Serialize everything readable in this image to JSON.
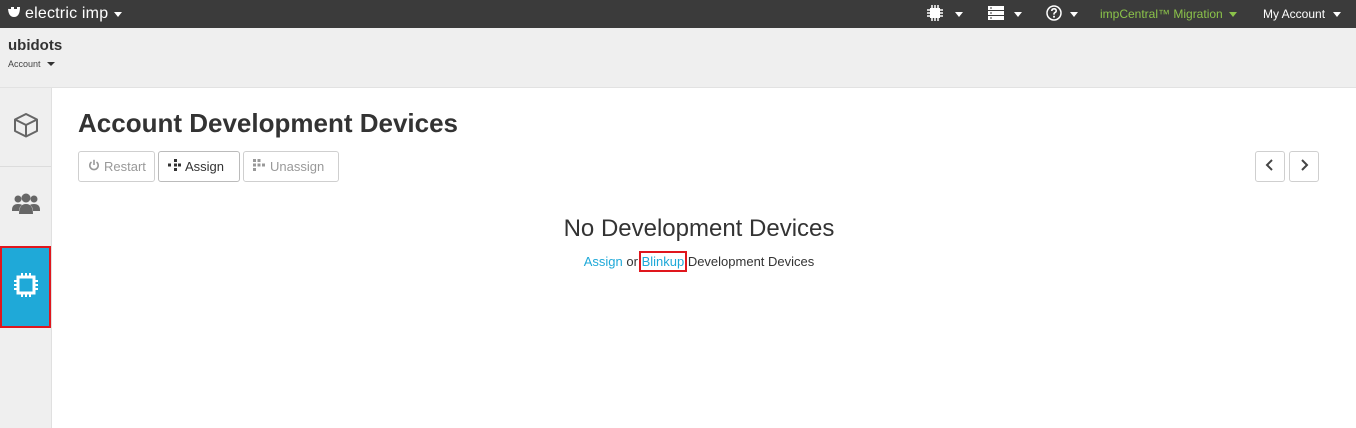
{
  "topbar": {
    "brand": "electric imp",
    "migration_label": "impCentral™ Migration",
    "account_label": "My Account",
    "icons": [
      "chip-icon",
      "server-icon",
      "help-icon"
    ]
  },
  "account": {
    "name": "ubidots",
    "switcher_label": "Account"
  },
  "sidebar": {
    "items": [
      {
        "icon": "cube-icon",
        "active": false
      },
      {
        "icon": "users-icon",
        "active": false
      },
      {
        "icon": "chip-icon",
        "active": true
      }
    ]
  },
  "main": {
    "title": "Account Development Devices",
    "buttons": {
      "restart": "Restart",
      "assign": "Assign",
      "unassign": "Unassign"
    },
    "empty_state": {
      "title": "No Development Devices",
      "assign_link": "Assign",
      "or_text": " or ",
      "blinkup_link": "Blinkup",
      "suffix_text": " Development Devices"
    }
  },
  "colors": {
    "topbar_bg": "#3b3b3b",
    "accent": "#1fa9d8",
    "migration_green": "#8bc34a",
    "highlight_red": "#e0161d"
  }
}
